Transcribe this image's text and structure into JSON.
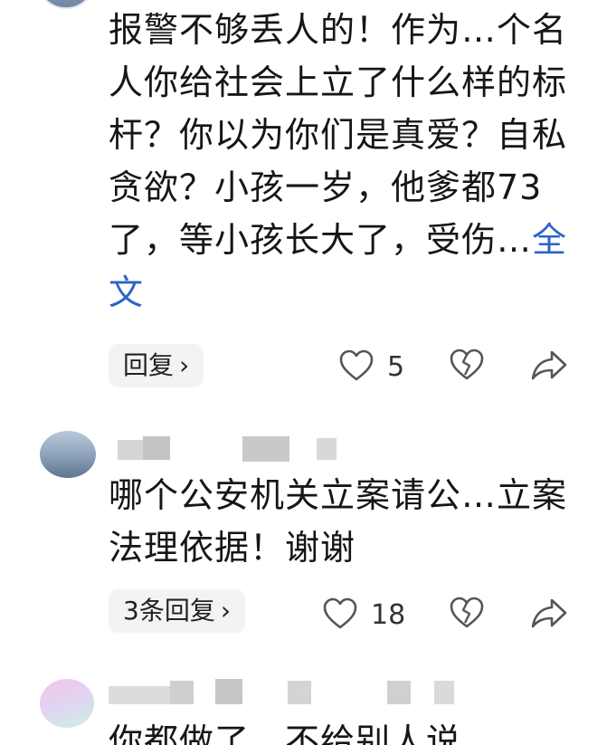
{
  "comments": [
    {
      "text": "报警不够丢人的！作为…个名人你给社会上立了什么样的标杆？你以为你们是真爱？自私贪欲？小孩一岁，他爹都73了，等小孩长大了，受伤…",
      "more_label": "全文",
      "reply_label": "回复",
      "likes": "5"
    },
    {
      "text": "哪个公安机关立案请公…立案法理依据！谢谢",
      "reply_label": "3条回复",
      "likes": "18"
    },
    {
      "text": "你都做了，不给别人说"
    }
  ],
  "icons": {
    "chevron": "›",
    "like": "heart-outline-icon",
    "dislike": "broken-heart-icon",
    "share": "share-arrow-icon"
  },
  "colors": {
    "link": "#2b63c9",
    "icon": "#555555"
  }
}
